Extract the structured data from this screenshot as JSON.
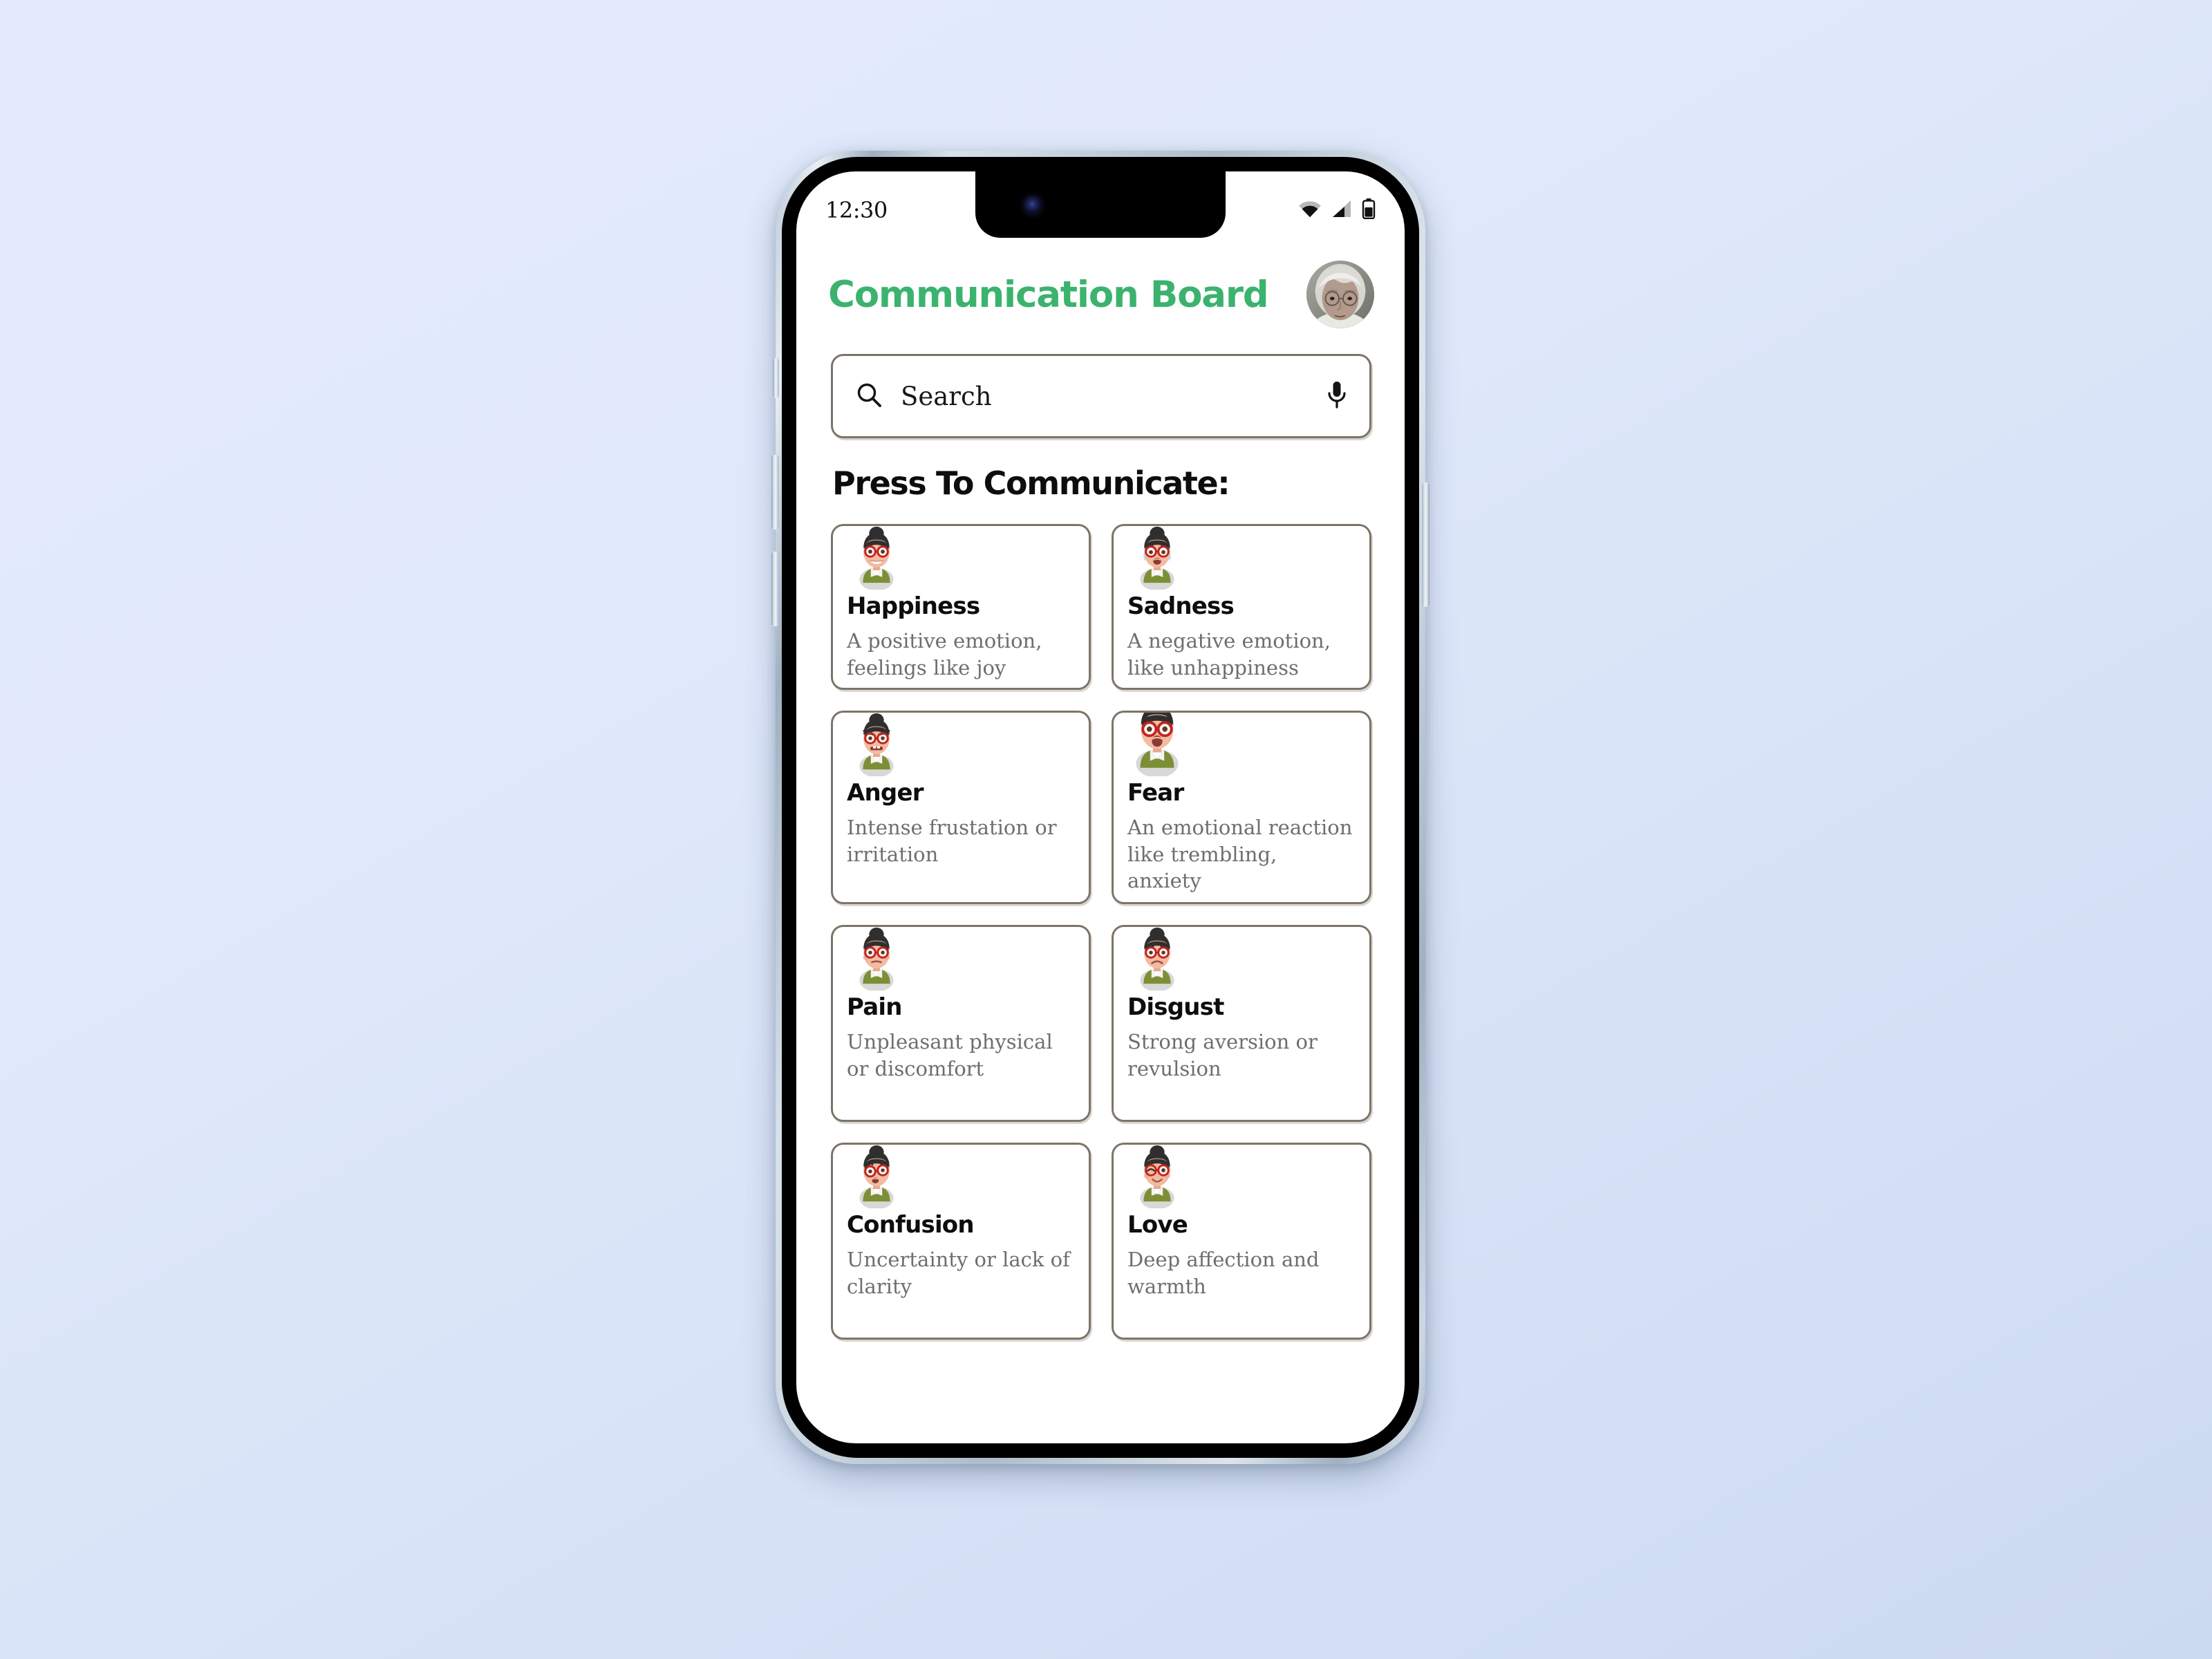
{
  "status_bar": {
    "time": "12:30",
    "icons": [
      "wifi-icon",
      "cellular-signal-icon",
      "battery-icon"
    ]
  },
  "header": {
    "title": "Communication Board",
    "title_color": "#3bb36e",
    "avatar": "profile-avatar-elderly-woman"
  },
  "search": {
    "placeholder": "Search",
    "search_icon": "search-icon",
    "mic_icon": "microphone-icon"
  },
  "section": {
    "title": "Press To Communicate:"
  },
  "cards": [
    {
      "name": "Happiness",
      "description": "A positive emotion, feelings like joy",
      "face": "happy-face-icon"
    },
    {
      "name": "Sadness",
      "description": "A negative emotion, like unhappiness",
      "face": "sad-face-icon"
    },
    {
      "name": "Anger",
      "description": "Intense frustation or irritation",
      "face": "angry-face-icon"
    },
    {
      "name": "Fear",
      "description": "An emotional reaction like trembling, anxiety",
      "face": "fearful-face-icon"
    },
    {
      "name": "Pain",
      "description": "Unpleasant physical or discomfort",
      "face": "pain-face-icon"
    },
    {
      "name": "Disgust",
      "description": "Strong aversion or revulsion",
      "face": "disgusted-face-icon"
    },
    {
      "name": "Confusion",
      "description": "Uncertainty or lack of clarity",
      "face": "confused-face-icon"
    },
    {
      "name": "Love",
      "description": "Deep affection and warmth",
      "face": "loving-face-icon"
    }
  ],
  "theme": {
    "background_gradient_start": "#e3eafc",
    "background_gradient_end": "#ccdaf1",
    "card_border": "#7d7468",
    "accent_green": "#3bb36e",
    "text_primary": "#0d0d0d",
    "text_secondary": "#6e6e6e",
    "hair_color": "#2b2b2b",
    "glasses_color": "#c32222",
    "shirt_color": "#7d8f35",
    "skin_color": "#f0b59a"
  }
}
